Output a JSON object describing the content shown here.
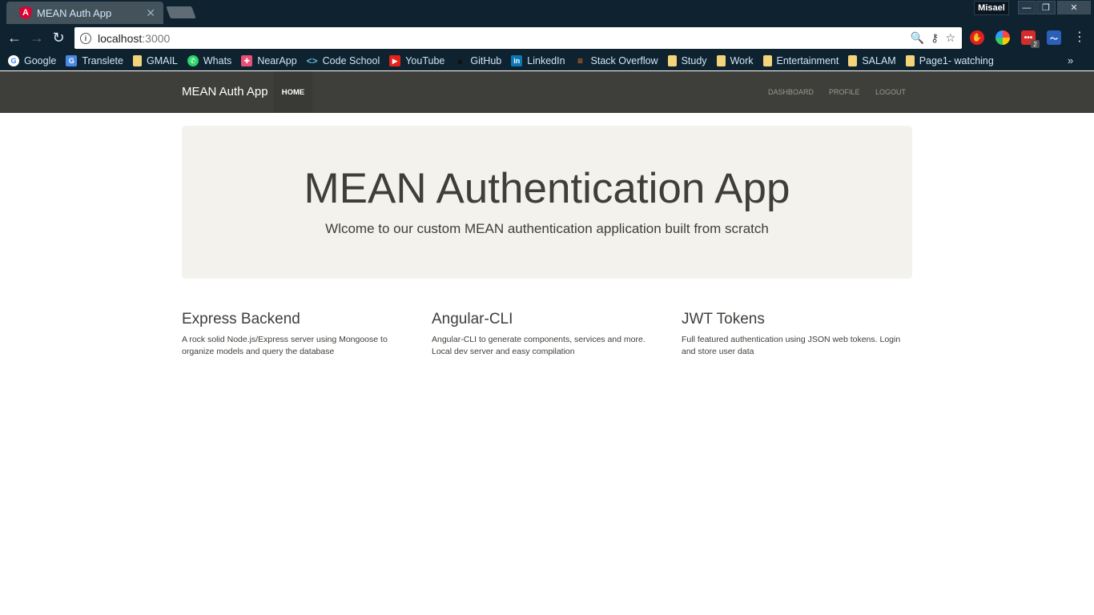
{
  "browser": {
    "tab_title": "MEAN Auth App",
    "tab_close": "✕",
    "favicon": "A",
    "profile_name": "Misael",
    "url_host": "localhost",
    "url_port": ":3000",
    "extension_badge": "2",
    "bookmarks": [
      {
        "label": "Google",
        "icon": "google-icon"
      },
      {
        "label": "Translete",
        "icon": "translate-icon"
      },
      {
        "label": "GMAIL",
        "icon": "folder-icon"
      },
      {
        "label": "Whats",
        "icon": "whatsapp-icon"
      },
      {
        "label": "NearApp",
        "icon": "nearapp-icon"
      },
      {
        "label": "Code School",
        "icon": "code-icon"
      },
      {
        "label": "YouTube",
        "icon": "youtube-icon"
      },
      {
        "label": "GitHub",
        "icon": "github-icon"
      },
      {
        "label": "LinkedIn",
        "icon": "linkedin-icon"
      },
      {
        "label": "Stack Overflow",
        "icon": "stackoverflow-icon"
      },
      {
        "label": "Study",
        "icon": "folder-icon"
      },
      {
        "label": "Work",
        "icon": "folder-icon"
      },
      {
        "label": "Entertainment",
        "icon": "folder-icon"
      },
      {
        "label": "SALAM",
        "icon": "folder-icon"
      },
      {
        "label": "Page1- watching",
        "icon": "folder-icon"
      }
    ]
  },
  "navbar": {
    "brand": "MEAN Auth App",
    "home": "HOME",
    "dashboard": "DASHBOARD",
    "profile": "PROFILE",
    "logout": "LOGOUT"
  },
  "jumbotron": {
    "title": "MEAN Authentication App",
    "subtitle": "Wlcome to our custom MEAN authentication application built from scratch"
  },
  "features": [
    {
      "title": "Express Backend",
      "text": "A rock solid Node.js/Express server using Mongoose to organize models and query the database"
    },
    {
      "title": "Angular-CLI",
      "text": "Angular-CLI to generate components, services and more. Local dev server and easy compilation"
    },
    {
      "title": "JWT Tokens",
      "text": "Full featured authentication using JSON web tokens. Login and store user data"
    }
  ],
  "colors": {
    "navbar_bg": "#3e3f3a",
    "jumbotron_bg": "#f4f2ed",
    "text": "#3e3f3a",
    "chrome_bg": "#0f2230"
  }
}
